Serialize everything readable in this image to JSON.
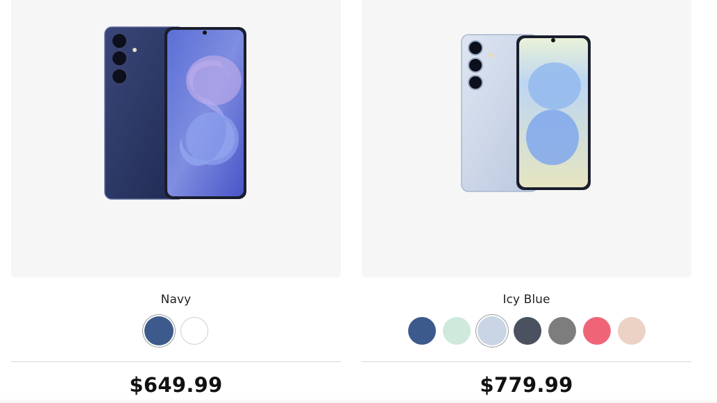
{
  "products": [
    {
      "image_alt": "",
      "color_name": "Navy",
      "price": "$649.99",
      "swatches": [
        {
          "name": "navy",
          "color": "#3c5a8c",
          "selected": true
        },
        {
          "name": "white",
          "color": "#ffffff",
          "selected": false
        }
      ]
    },
    {
      "image_alt": "",
      "color_name": "Icy Blue",
      "price": "$779.99",
      "swatches": [
        {
          "name": "blue",
          "color": "#3c5a8c",
          "selected": false
        },
        {
          "name": "mint",
          "color": "#cfe9dc",
          "selected": false
        },
        {
          "name": "icy-blue",
          "color": "#c9d5e4",
          "selected": true
        },
        {
          "name": "dark-slate",
          "color": "#4a5160",
          "selected": false
        },
        {
          "name": "gray",
          "color": "#7d7d7d",
          "selected": false
        },
        {
          "name": "coral",
          "color": "#ef6577",
          "selected": false
        },
        {
          "name": "peach",
          "color": "#ecd2c5",
          "selected": false
        }
      ]
    }
  ],
  "colors": {
    "panel_bg": "#f6f6f6",
    "divider": "#d6d6d6",
    "navy_body": "#2b3763",
    "icy_body": "#cdd7e8"
  }
}
